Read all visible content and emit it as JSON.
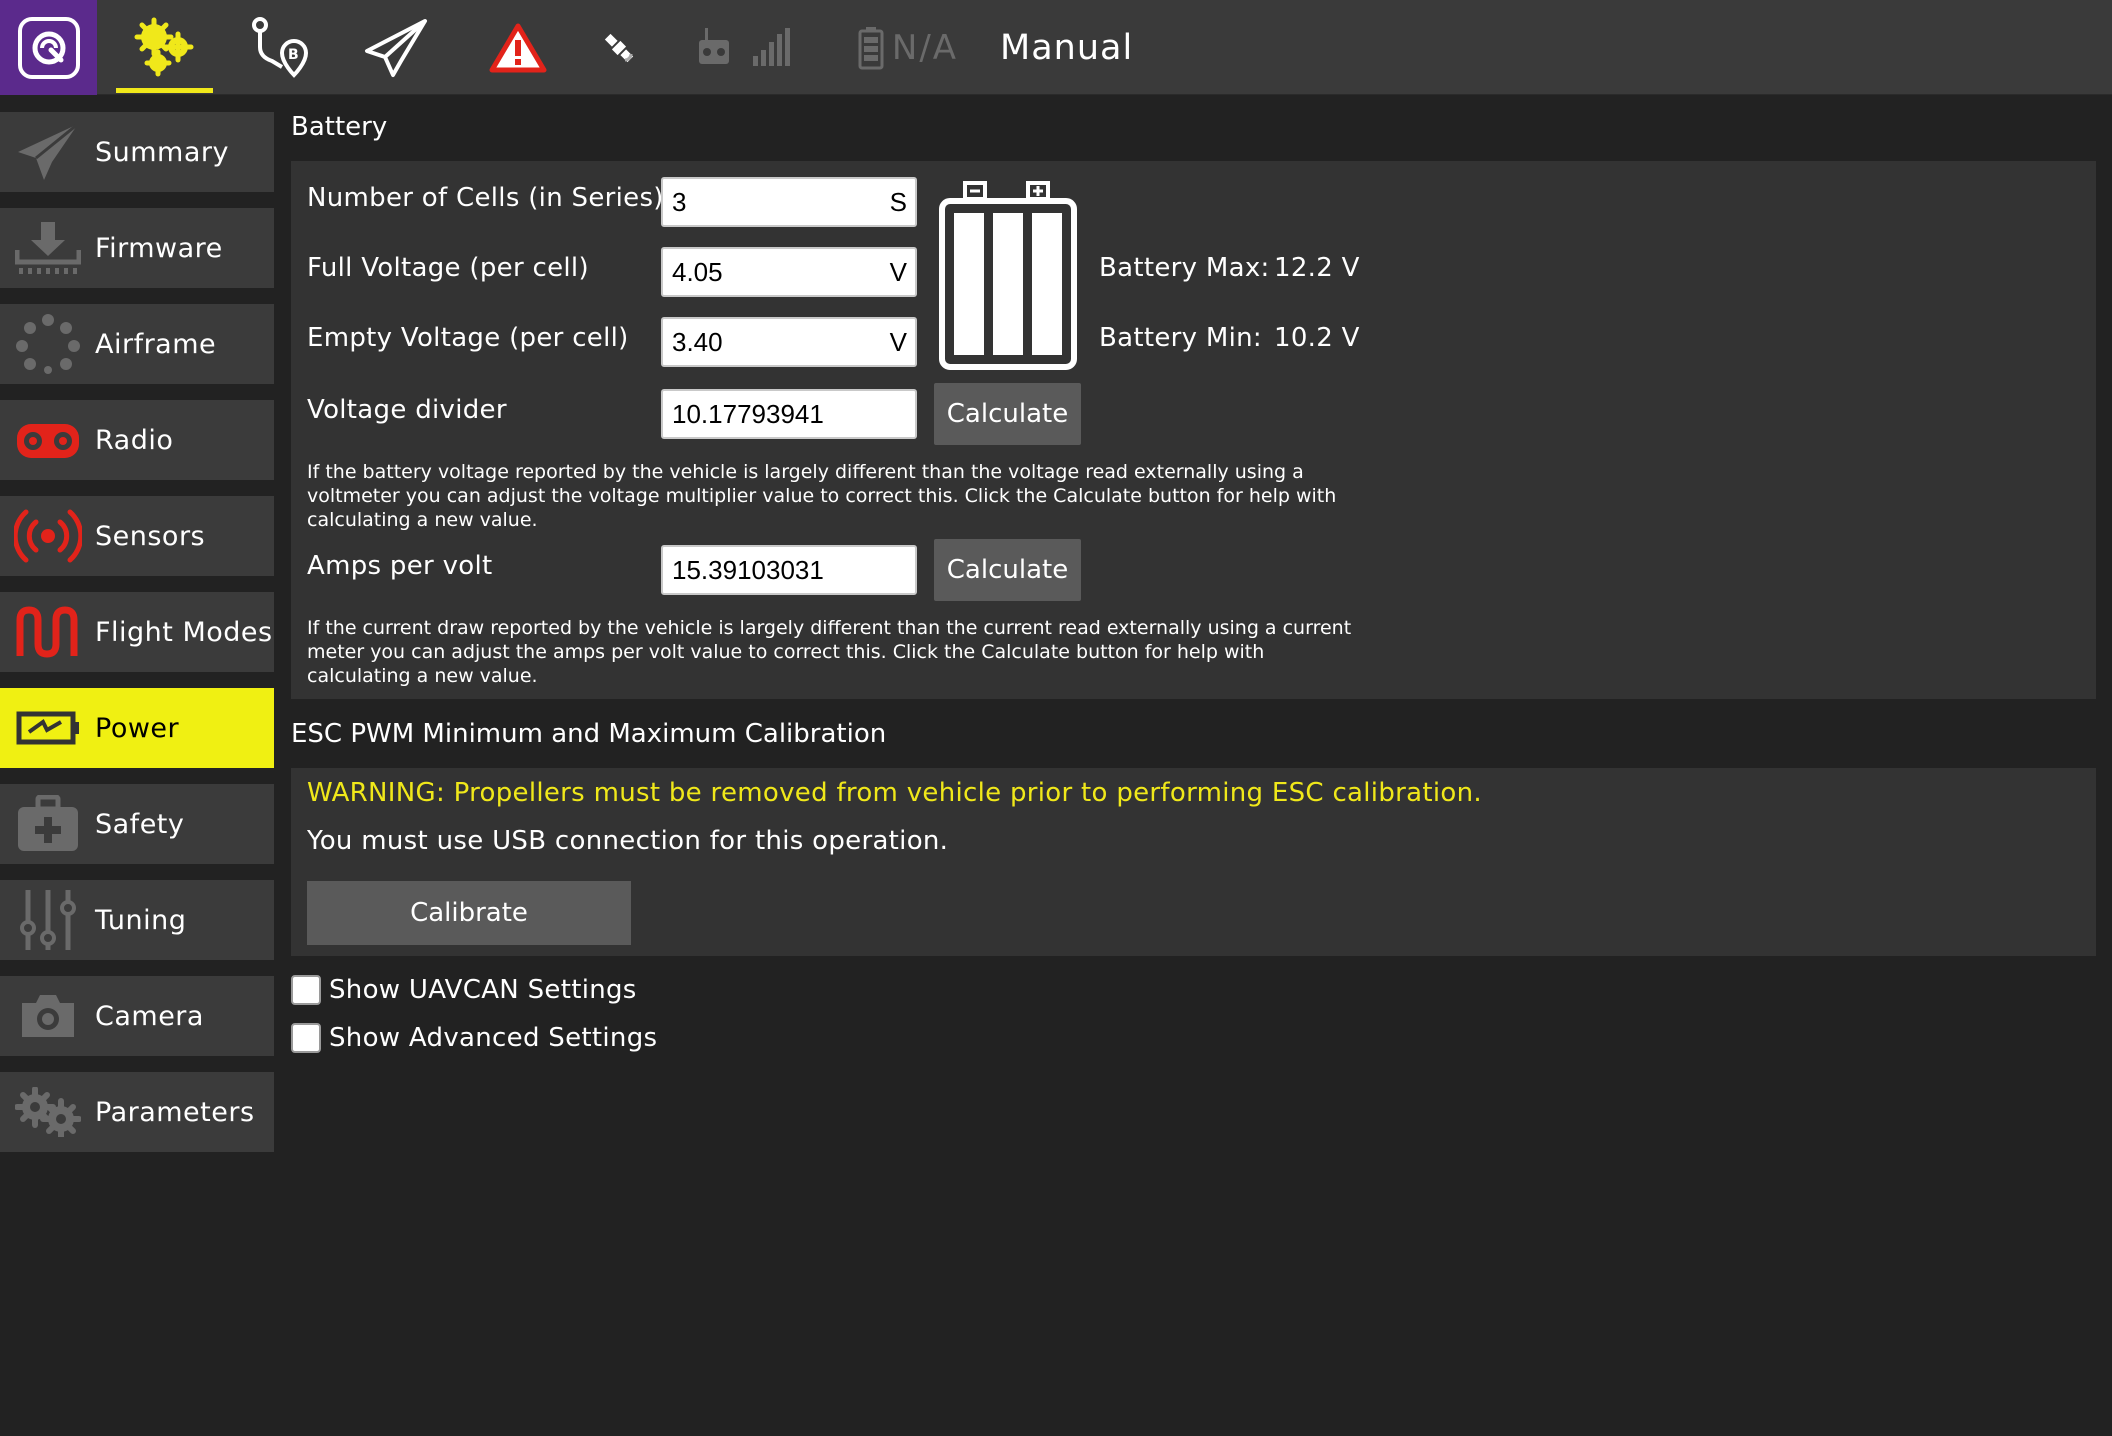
{
  "toolbar": {
    "logo_icon": "qgc-logo-icon",
    "settings_icon": "vehicle-setup-gears-icon",
    "plan_icon": "plan-route-icon",
    "fly_icon": "fly-paper-plane-icon",
    "warning_icon": "warning-triangle-icon",
    "gps_icon": "gps-satellite-icon",
    "rc_icon": "rc-signal-icon",
    "battery_icon": "battery-icon",
    "battery_status": "N/A",
    "flight_mode": "Manual",
    "accent_color": "#f0e81a"
  },
  "sidebar": {
    "items": [
      {
        "label": "Summary",
        "icon": "paper-plane-icon"
      },
      {
        "label": "Firmware",
        "icon": "download-icon"
      },
      {
        "label": "Airframe",
        "icon": "airframe-dots-icon"
      },
      {
        "label": "Radio",
        "icon": "radio-controller-icon"
      },
      {
        "label": "Sensors",
        "icon": "sensors-signal-icon"
      },
      {
        "label": "Flight Modes",
        "icon": "flight-modes-wave-icon"
      },
      {
        "label": "Power",
        "icon": "power-battery-icon",
        "active": true
      },
      {
        "label": "Safety",
        "icon": "safety-kit-icon"
      },
      {
        "label": "Tuning",
        "icon": "tuning-sliders-icon"
      },
      {
        "label": "Camera",
        "icon": "camera-icon"
      },
      {
        "label": "Parameters",
        "icon": "parameters-gears-icon"
      }
    ]
  },
  "battery": {
    "title": "Battery",
    "cells_label": "Number of Cells (in Series)",
    "cells_value": "3",
    "cells_unit": "S",
    "full_label": "Full Voltage (per cell)",
    "full_value": "4.05",
    "full_unit": "V",
    "empty_label": "Empty Voltage (per cell)",
    "empty_value": "3.40",
    "empty_unit": "V",
    "divider_label": "Voltage divider",
    "divider_value": "10.17793941",
    "divider_button": "Calculate",
    "divider_help": "If the battery voltage reported by the vehicle is largely different than the voltage read externally using a voltmeter you can adjust the voltage multiplier value to correct this. Click the Calculate button for help with calculating a new value.",
    "amps_label": "Amps per volt",
    "amps_value": "15.39103031",
    "amps_button": "Calculate",
    "amps_help": "If the current draw reported by the vehicle is largely different than the current read externally using a current meter you can adjust the amps per volt value to correct this. Click the Calculate button for help with calculating a new value.",
    "max_label": "Battery Max:",
    "max_value": "12.2 V",
    "min_label": "Battery Min:",
    "min_value": "10.2 V",
    "battery_graphic_icon": "battery-cells-icon"
  },
  "esc": {
    "title": "ESC PWM Minimum and Maximum Calibration",
    "warning": "WARNING: Propellers must be removed from vehicle prior to performing ESC calibration.",
    "usb_note": "You must use USB connection for this operation.",
    "calibrate_button": "Calibrate"
  },
  "options": {
    "uavcan_label": "Show UAVCAN Settings",
    "uavcan_checked": false,
    "advanced_label": "Show Advanced Settings",
    "advanced_checked": false
  }
}
